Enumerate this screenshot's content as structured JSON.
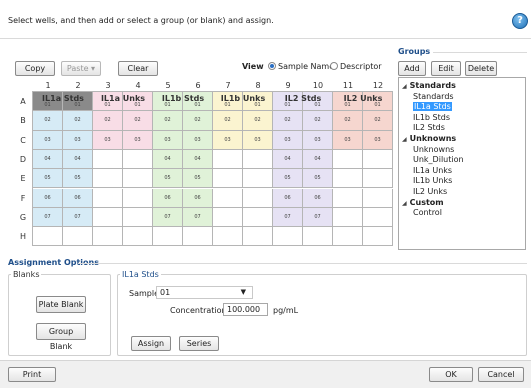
{
  "instruction": "Select wells, and then add or select a group (or blank) and assign.",
  "help_icon": "?",
  "toolbar": {
    "copy": "Copy",
    "paste": "Paste ▾",
    "clear": "Clear",
    "view_label": "View",
    "view_options": [
      "Sample Name",
      "Descriptor"
    ]
  },
  "plate": {
    "columns": [
      "1",
      "2",
      "3",
      "4",
      "5",
      "6",
      "7",
      "8",
      "9",
      "10",
      "11",
      "12"
    ],
    "rows": [
      "A",
      "B",
      "C",
      "D",
      "E",
      "F",
      "G",
      "H"
    ],
    "groups": [
      {
        "name": "IL1a Stds",
        "color": "#d6ebf6",
        "cols": [
          0,
          1
        ]
      },
      {
        "name": "IL1a Unks",
        "color": "#f8dde6",
        "cols": [
          2,
          3
        ]
      },
      {
        "name": "IL1b Stds",
        "color": "#e0f2d8",
        "cols": [
          4,
          5
        ]
      },
      {
        "name": "IL1b Unks",
        "color": "#fbf4d0",
        "cols": [
          6,
          7
        ]
      },
      {
        "name": "IL2 Stds",
        "color": "#e6e2f4",
        "cols": [
          8,
          9
        ]
      },
      {
        "name": "IL2 Unks",
        "color": "#f6d6cf",
        "cols": [
          10,
          11
        ]
      }
    ],
    "cell_values": [
      [
        "01",
        "01",
        "01",
        "01",
        "01",
        "01",
        "01",
        "01",
        "01",
        "01",
        "01",
        "01"
      ],
      [
        "02",
        "02",
        "02",
        "02",
        "02",
        "02",
        "02",
        "02",
        "02",
        "02",
        "02",
        "02"
      ],
      [
        "03",
        "03",
        "03",
        "03",
        "03",
        "03",
        "03",
        "03",
        "03",
        "03",
        "03",
        "03"
      ],
      [
        "04",
        "04",
        "",
        "",
        "04",
        "04",
        "",
        "",
        "04",
        "04",
        "",
        ""
      ],
      [
        "05",
        "05",
        "",
        "",
        "05",
        "05",
        "",
        "",
        "05",
        "05",
        "",
        ""
      ],
      [
        "06",
        "06",
        "",
        "",
        "06",
        "06",
        "",
        "",
        "06",
        "06",
        "",
        ""
      ],
      [
        "07",
        "07",
        "",
        "",
        "07",
        "07",
        "",
        "",
        "07",
        "07",
        "",
        ""
      ],
      [
        "",
        "",
        "",
        "",
        "",
        "",
        "",
        "",
        "",
        "",
        "",
        ""
      ]
    ],
    "filled_rows": [
      [
        1,
        1,
        1,
        1,
        1,
        1,
        1,
        1,
        1,
        1,
        1,
        1
      ],
      [
        1,
        1,
        1,
        1,
        1,
        1,
        1,
        1,
        1,
        1,
        1,
        1
      ],
      [
        1,
        1,
        1,
        1,
        1,
        1,
        1,
        1,
        1,
        1,
        1,
        1
      ],
      [
        1,
        1,
        0,
        0,
        1,
        1,
        0,
        0,
        1,
        1,
        0,
        0
      ],
      [
        1,
        1,
        0,
        0,
        1,
        1,
        0,
        0,
        1,
        1,
        0,
        0
      ],
      [
        1,
        1,
        0,
        0,
        1,
        1,
        0,
        0,
        1,
        1,
        0,
        0
      ],
      [
        1,
        1,
        0,
        0,
        1,
        1,
        0,
        0,
        1,
        1,
        0,
        0
      ],
      [
        0,
        0,
        0,
        0,
        0,
        0,
        0,
        0,
        0,
        0,
        0,
        0
      ]
    ]
  },
  "groups_panel": {
    "title": "Groups",
    "buttons": [
      "Add",
      "Edit",
      "Delete"
    ],
    "tree": [
      {
        "label": "Standards",
        "head": true
      },
      {
        "label": "Standards",
        "head": false
      },
      {
        "label": "IL1a Stds",
        "head": false,
        "selected": true
      },
      {
        "label": "IL1b Stds",
        "head": false
      },
      {
        "label": "IL2 Stds",
        "head": false
      },
      {
        "label": "Unknowns",
        "head": true
      },
      {
        "label": "Unknowns",
        "head": false
      },
      {
        "label": "Unk_Dilution",
        "head": false
      },
      {
        "label": "IL1a Unks",
        "head": false
      },
      {
        "label": "IL1b Unks",
        "head": false
      },
      {
        "label": "IL2 Unks",
        "head": false
      },
      {
        "label": "Custom",
        "head": true
      },
      {
        "label": "Control",
        "head": false
      }
    ]
  },
  "assignment": {
    "title": "Assignment Options",
    "blanks_label": "Blanks",
    "plate_blank": "Plate Blank",
    "group_blank": "Group Blank",
    "group_title": "IL1a Stds",
    "sample_label": "Sample",
    "sample_value": "01",
    "concentration_label": "Concentration",
    "concentration_value": "100.000",
    "unit": "pg/mL",
    "assign": "Assign",
    "series": "Series"
  },
  "footer": {
    "print": "Print",
    "ok": "OK",
    "cancel": "Cancel"
  }
}
